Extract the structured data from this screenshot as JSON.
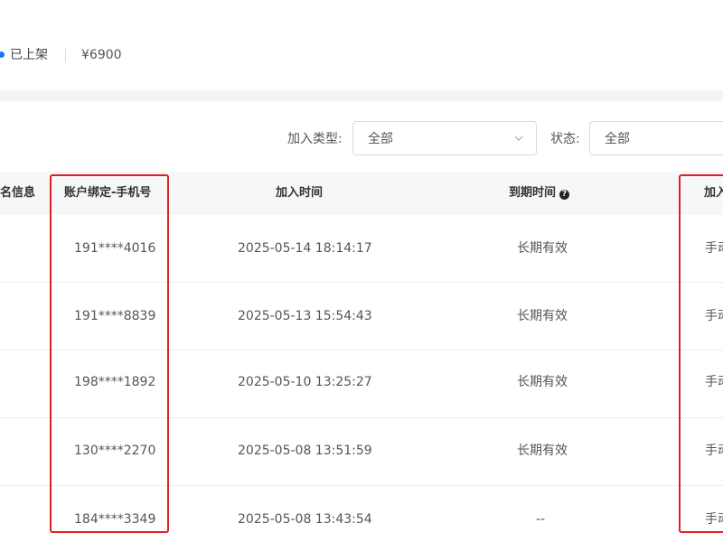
{
  "product": {
    "status": "已上架",
    "price": "¥6900"
  },
  "filters": {
    "join_type_label": "加入类型:",
    "join_type_value": "全部",
    "status_label": "状态:",
    "status_value": "全部"
  },
  "table": {
    "headers": {
      "col1": "名信息",
      "phone": "账户绑定-手机号",
      "join_time": "加入时间",
      "expire_time": "到期时间",
      "join_method": "加入"
    },
    "rows": [
      {
        "phone": "191****4016",
        "join_time": "2025-05-14 18:14:17",
        "expire": "长期有效",
        "method": "手动"
      },
      {
        "phone": "191****8839",
        "join_time": "2025-05-13 15:54:43",
        "expire": "长期有效",
        "method": "手动"
      },
      {
        "phone": "198****1892",
        "join_time": "2025-05-10 13:25:27",
        "expire": "长期有效",
        "method": "手动"
      },
      {
        "phone": "130****2270",
        "join_time": "2025-05-08 13:51:59",
        "expire": "长期有效",
        "method": "手动"
      },
      {
        "phone": "184****3349",
        "join_time": "2025-05-08 13:43:54",
        "expire": "--",
        "method": "手动"
      }
    ]
  },
  "colors": {
    "accent": "#1677ff",
    "highlight": "#e02020"
  }
}
